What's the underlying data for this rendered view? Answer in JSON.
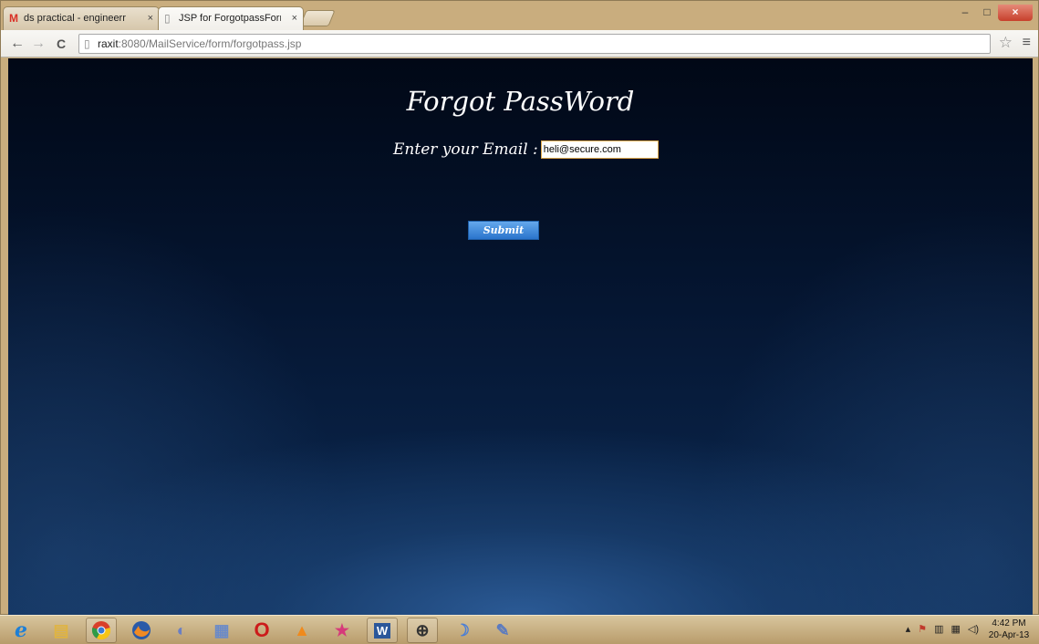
{
  "browser": {
    "tabs": [
      {
        "title": "ds practical - engineerraxit",
        "favicon": "gmail-icon",
        "active": false
      },
      {
        "title": "JSP for ForgotpassForm fo",
        "favicon": "page-icon",
        "active": true
      }
    ],
    "tab_close_glyph": "×",
    "window_controls": {
      "minimize": "–",
      "maximize": "□",
      "close": "×"
    },
    "nav": {
      "back": "←",
      "forward": "→",
      "reload": "C"
    },
    "url": {
      "host": "raxit",
      "rest": ":8080/MailService/form/forgotpass.jsp"
    },
    "star": "☆",
    "menu": "≡"
  },
  "page": {
    "title": "Forgot PassWord",
    "email_label": "Enter your Email :",
    "email_value": "heli@secure.com",
    "submit_label": "Submit"
  },
  "taskbar": {
    "apps": [
      "internet-explorer-icon",
      "file-explorer-icon",
      "chrome-icon",
      "firefox-icon",
      "eclipse-icon",
      "database-icon",
      "opera-icon",
      "vlc-icon",
      "star-app-icon",
      "word-icon",
      "paint-tool-icon",
      "dolphin-icon",
      "paint-icon"
    ],
    "clock_time": "4:42 PM",
    "clock_date": "20-Apr-13"
  },
  "colors": {
    "tab_bar": "#c9ad7e",
    "page_top": "#010816",
    "page_bottom": "#0c2b55",
    "submit_button": "#3a86d8",
    "input_border": "#e0a94c"
  }
}
